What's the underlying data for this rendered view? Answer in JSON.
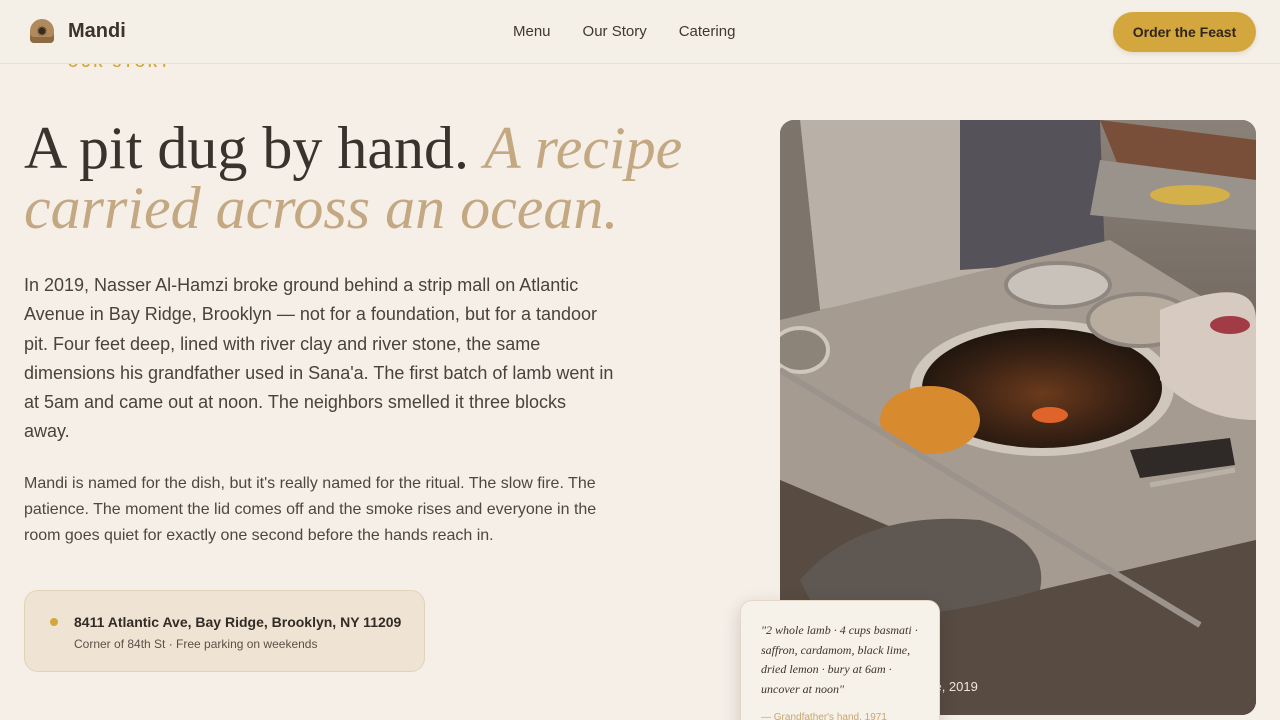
{
  "nav": {
    "brand": "Mandi",
    "brand_icon": "sunburst-logo-icon",
    "links": [
      "Menu",
      "Our Story",
      "Catering"
    ],
    "cta_label": "Order the Feast"
  },
  "hero": {
    "eyebrow": "OUR STORY",
    "headline_plain": "A pit dug by hand.",
    "headline_accent": "A recipe carried across an ocean.",
    "lead": "In 2019, Nasser Al-Hamzi broke ground behind a strip mall on Atlantic Avenue in Bay Ridge, Brooklyn — not for a foundation, but for a tandoor pit. Four feet deep, lined with river clay and river stone, the same dimensions his grandfather used in Sana'a. The first batch of lamb went in at 5am and came out at noon. The neighbors smelled it three blocks away.",
    "paragraph": "Mandi is named for the dish, but it's really named for the ritual. The slow fire. The patience. The moment the lid comes off and the smoke rises and everyone in the room goes quiet for exactly one second before the hands reach in."
  },
  "address": {
    "line1": "8411 Atlantic Ave, Bay Ridge, Brooklyn, NY 11209",
    "line2": "Corner of 84th St · Free parking on weekends"
  },
  "photo": {
    "caption": "dge, 2019"
  },
  "recipe_card": {
    "quote": "\"2 whole lamb · 4 cups basmati · saffron, cardamom, black lime, dried lemon · bury at 6am · uncover at noon\"",
    "attribution": "— Grandfather's hand, 1971"
  },
  "colors": {
    "background": "#f5efe8",
    "accent_gold": "#d4a63e",
    "accent_tan": "#c3a882",
    "text_dark": "#3a332d"
  }
}
